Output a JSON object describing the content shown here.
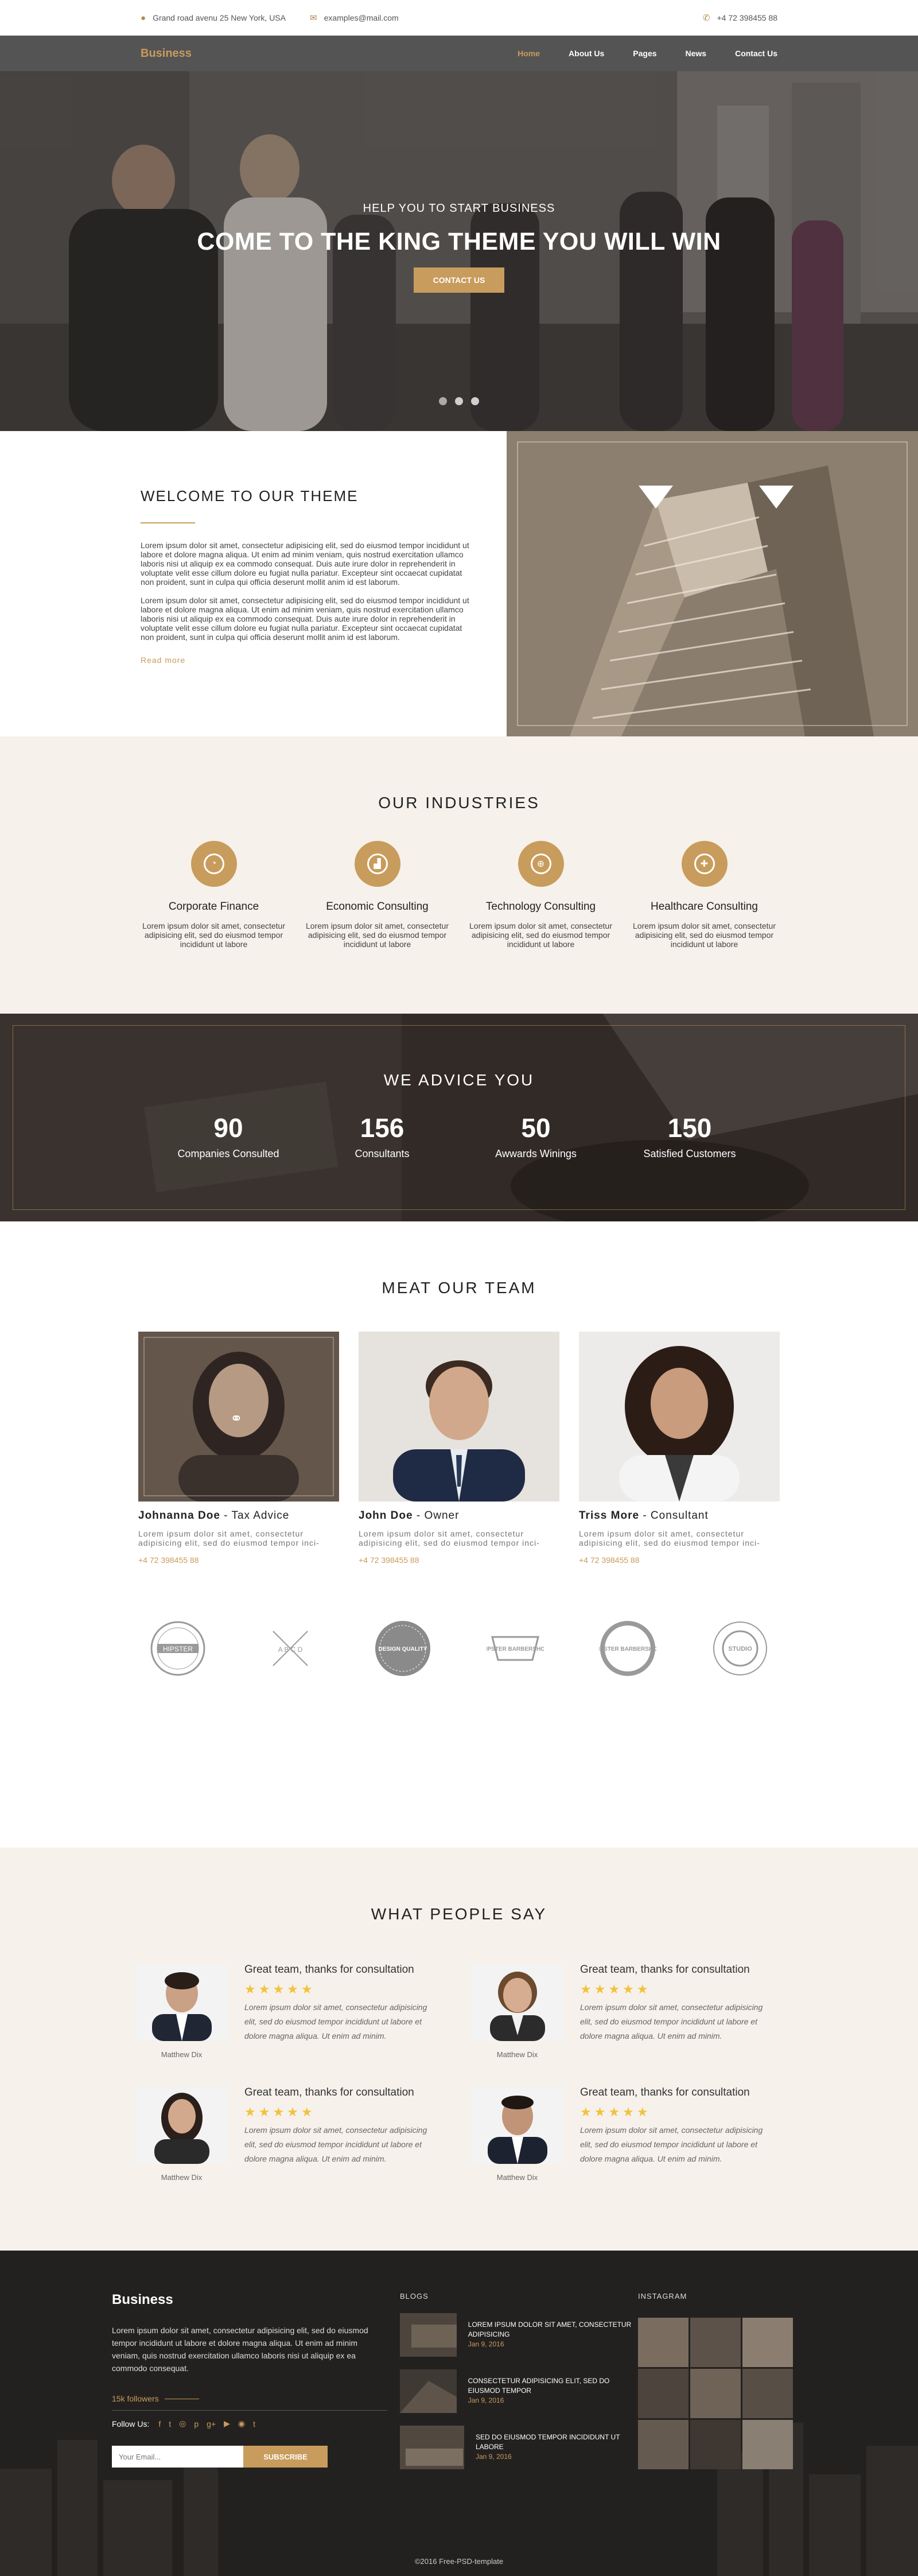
{
  "topbar": {
    "address": "Grand road avenu 25 New York, USA",
    "email": "examples@mail.com",
    "phone": "+4 72 398455 88"
  },
  "nav": {
    "logo": "Business",
    "items": [
      "Home",
      "About Us",
      "Pages",
      "News",
      "Contact Us"
    ],
    "active": "Home"
  },
  "hero": {
    "subtitle": "HELP YOU TO START BUSINESS",
    "title": "COME TO THE KING THEME  YOU WILL WIN",
    "button": "CONTACT US",
    "slides": 3,
    "active_slide": 1
  },
  "welcome": {
    "title": "WELCOME TO OUR THEME",
    "paragraphs": [
      "Lorem ipsum dolor sit amet, consectetur adipisicing elit, sed do eiusmod tempor incididunt ut labore et dolore magna aliqua. Ut enim ad minim veniam, quis nostrud exercitation ullamco laboris nisi ut aliquip ex ea commodo consequat. Duis aute irure dolor in reprehenderit in voluptate velit esse cillum dolore eu fugiat nulla pariatur. Excepteur sint occaecat cupidatat non proident, sunt in culpa qui officia deserunt mollit anim id est laborum.",
      "Lorem ipsum dolor sit amet, consectetur adipisicing elit, sed do eiusmod tempor incididunt ut labore et dolore magna aliqua. Ut enim ad minim veniam, quis nostrud exercitation ullamco laboris nisi ut aliquip ex ea commodo consequat. Duis aute irure dolor in reprehenderit in voluptate velit esse cillum dolore eu fugiat nulla pariatur. Excepteur sint occaecat cupidatat non proident, sunt in culpa qui officia deserunt mollit anim id est laborum."
    ],
    "read_more": "Read more"
  },
  "industries": {
    "title": "OUR INDUSTRIES",
    "items": [
      {
        "title": "Corporate Finance",
        "text": "Lorem ipsum dolor sit amet, consectetur adipisicing elit, sed do eiusmod tempor incididunt ut labore",
        "icon": "pie-chart-icon"
      },
      {
        "title": "Economic Consulting",
        "text": "Lorem ipsum dolor sit amet, consectetur adipisicing elit, sed do eiusmod tempor incididunt ut labore",
        "icon": "bar-chart-icon"
      },
      {
        "title": "Technology Consulting",
        "text": "Lorem ipsum dolor sit amet, consectetur adipisicing elit, sed do eiusmod tempor incididunt ut labore",
        "icon": "globe-icon"
      },
      {
        "title": "Healthcare Consulting",
        "text": "Lorem ipsum dolor sit amet, consectetur adipisicing elit, sed do eiusmod tempor incididunt ut labore",
        "icon": "medical-case-icon"
      }
    ]
  },
  "advice": {
    "title": "WE ADVICE YOU",
    "stats": [
      {
        "num": "90",
        "label": "Companies Consulted"
      },
      {
        "num": "156",
        "label": "Consultants"
      },
      {
        "num": "50",
        "label": "Awwards Winings"
      },
      {
        "num": "150",
        "label": "Satisfied Customers"
      }
    ]
  },
  "team": {
    "title": "MEAT OUR TEAM",
    "members": [
      {
        "name": "Johnanna Doe",
        "role": " - Tax Advice",
        "desc": "Lorem ipsum dolor sit amet, consectetur adipisicing elit, sed do eiusmod tempor inci-",
        "phone": "+4 72 398455 88"
      },
      {
        "name": "John Doe",
        "role": " - Owner",
        "desc": "Lorem ipsum dolor sit amet, consectetur adipisicing elit, sed do eiusmod tempor inci-",
        "phone": "+4 72 398455 88"
      },
      {
        "name": "Triss More",
        "role": " - Consultant",
        "desc": "Lorem ipsum dolor sit amet, consectetur adipisicing elit, sed do eiusmod tempor inci-",
        "phone": "+4 72 398455 88"
      }
    ]
  },
  "logos": [
    "HIPSTER",
    "A B C D",
    "DESIGN QUALITY",
    "HIPSTER BARBERSHOP",
    "HIPSTER BARBERSHOP",
    "STUDIO"
  ],
  "testimonials": {
    "title": "WHAT PEOPLE SAY",
    "items": [
      {
        "title": "Great team, thanks for consultation",
        "name": "Matthew Dix",
        "text": "Lorem ipsum dolor sit amet, consectetur adipisicing elit, sed do eiusmod tempor incididunt ut labore et dolore magna aliqua. Ut enim ad minim.",
        "rating": 5
      },
      {
        "title": "Great team, thanks for consultation",
        "name": "Matthew Dix",
        "text": "Lorem ipsum dolor sit amet, consectetur adipisicing elit, sed do eiusmod tempor incididunt ut labore et dolore magna aliqua. Ut enim ad minim.",
        "rating": 5
      },
      {
        "title": "Great team, thanks for consultation",
        "name": "Matthew Dix",
        "text": "Lorem ipsum dolor sit amet, consectetur adipisicing elit, sed do eiusmod tempor incididunt ut labore et dolore magna aliqua. Ut enim ad minim.",
        "rating": 5
      },
      {
        "title": "Great team, thanks for consultation",
        "name": "Matthew Dix",
        "text": "Lorem ipsum dolor sit amet, consectetur adipisicing elit, sed do eiusmod tempor incididunt ut labore et dolore magna aliqua. Ut enim ad minim.",
        "rating": 5
      }
    ],
    "stars": "★★★★★"
  },
  "footer": {
    "logo": "Business",
    "text": "Lorem ipsum dolor sit amet, consectetur adipisicing elit, sed do eiusmod tempor incididunt ut labore et dolore magna aliqua. Ut enim ad minim veniam, quis nostrud exercitation ullamco laboris nisi ut aliquip ex ea commodo consequat.",
    "followers": "15k followers",
    "follow_label": "Follow Us:",
    "social": [
      "f",
      "t",
      "◎",
      "p",
      "g+",
      "▶",
      "◉",
      "t"
    ],
    "email_placeholder": "Your Email...",
    "subscribe": "SUBSCRIBE",
    "blogs_title": "BLOGS",
    "posts": [
      {
        "title": "LOREM IPSUM DOLOR SIT AMET, CONSECTETUR ADIPISICING",
        "date": "Jan 9, 2016"
      },
      {
        "title": "CONSECTETUR ADIPISICING ELIT, SED DO EIUSMOD TEMPOR",
        "date": "Jan 9, 2016"
      },
      {
        "title": "SED DO EIUSMOD TEMPOR INCIDIDUNT UT LABORE",
        "date": "Jan 9, 2016"
      }
    ],
    "instagram_title": "INSTAGRAM",
    "copyright": "©2016 Free-PSD-template"
  },
  "colors": {
    "accent": "#c89c5c",
    "nav": "#555454",
    "cream": "#f6f1ea",
    "footer": "#1f1d1c",
    "star": "#f2c23b"
  }
}
